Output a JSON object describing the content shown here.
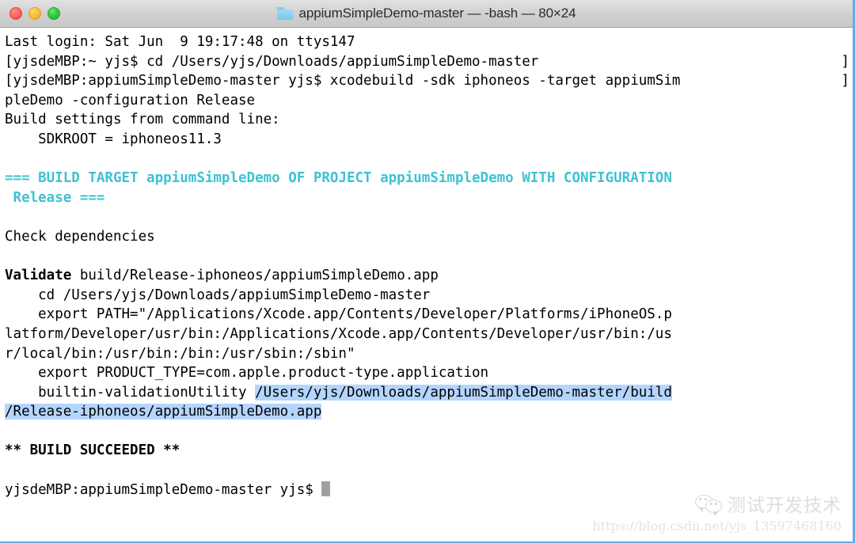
{
  "window": {
    "title": "appiumSimpleDemo-master — -bash — 80×24",
    "folder_icon": "folder-icon",
    "traffic_lights": [
      {
        "name": "close-button",
        "color": "#f9635a"
      },
      {
        "name": "minimize-button",
        "color": "#f9bb32"
      },
      {
        "name": "maximize-button",
        "color": "#2bc53a"
      }
    ]
  },
  "colors": {
    "cyan": "#3ec2d2",
    "selection": "#b4d5fe",
    "cursor": "#a0a0a0",
    "text": "#000000",
    "background": "#ffffff",
    "titlebar": "#cfcfcf",
    "window_border": "#6ea8e8"
  },
  "terminal": {
    "cols": 80,
    "rows": 24,
    "shell": "-bash",
    "lines": [
      {
        "id": 1,
        "text": "Last login: Sat Jun  9 19:17:48 on ttys147"
      },
      {
        "id": 2,
        "text": "[yjsdeMBP:~ yjs$ cd /Users/yjs/Downloads/appiumSimpleDemo-master",
        "wrapmark": "]"
      },
      {
        "id": 3,
        "text": "[yjsdeMBP:appiumSimpleDemo-master yjs$ xcodebuild -sdk iphoneos -target appiumSim",
        "wrapmark": "]"
      },
      {
        "id": 4,
        "text": "pleDemo -configuration Release"
      },
      {
        "id": 5,
        "text": "Build settings from command line:"
      },
      {
        "id": 6,
        "text": "    SDKROOT = iphoneos11.3"
      },
      {
        "id": 7,
        "text": ""
      },
      {
        "id": 8,
        "text": "=== BUILD TARGET appiumSimpleDemo OF PROJECT appiumSimpleDemo WITH CONFIGURATION",
        "style": "cyan"
      },
      {
        "id": 9,
        "text": " Release ===",
        "style": "cyan"
      },
      {
        "id": 10,
        "text": ""
      },
      {
        "id": 11,
        "text": "Check dependencies"
      },
      {
        "id": 12,
        "text": ""
      },
      {
        "id": 13,
        "text": "Validate build/Release-iphoneos/appiumSimpleDemo.app",
        "bold_prefix": "Validate"
      },
      {
        "id": 14,
        "text": "    cd /Users/yjs/Downloads/appiumSimpleDemo-master"
      },
      {
        "id": 15,
        "text": "    export PATH=\"/Applications/Xcode.app/Contents/Developer/Platforms/iPhoneOS.p"
      },
      {
        "id": 16,
        "text": "latform/Developer/usr/bin:/Applications/Xcode.app/Contents/Developer/usr/bin:/us"
      },
      {
        "id": 17,
        "text": "r/local/bin:/usr/bin:/bin:/usr/sbin:/sbin\""
      },
      {
        "id": 18,
        "text": "    export PRODUCT_TYPE=com.apple.product-type.application"
      },
      {
        "id": 19,
        "text": "    builtin-validationUtility ",
        "selected_text": "/Users/yjs/Downloads/appiumSimpleDemo-master/build"
      },
      {
        "id": 20,
        "text": "",
        "selected_text": "/Release-iphoneos/appiumSimpleDemo.app"
      },
      {
        "id": 21,
        "text": ""
      },
      {
        "id": 22,
        "text": "** BUILD SUCCEEDED **",
        "style": "bold"
      },
      {
        "id": 23,
        "text": ""
      },
      {
        "id": 24,
        "text": "yjsdeMBP:appiumSimpleDemo-master yjs$ ",
        "cursor": true
      }
    ],
    "prompt": "yjsdeMBP:appiumSimpleDemo-master yjs$",
    "selection": "/Users/yjs/Downloads/appiumSimpleDemo-master/build/Release-iphoneos/appiumSimpleDemo.app"
  },
  "watermark": {
    "icon": "wechat-icon",
    "text": "测试开发技术",
    "url": "https://blog.csdn.net/yjs_13597468160"
  }
}
